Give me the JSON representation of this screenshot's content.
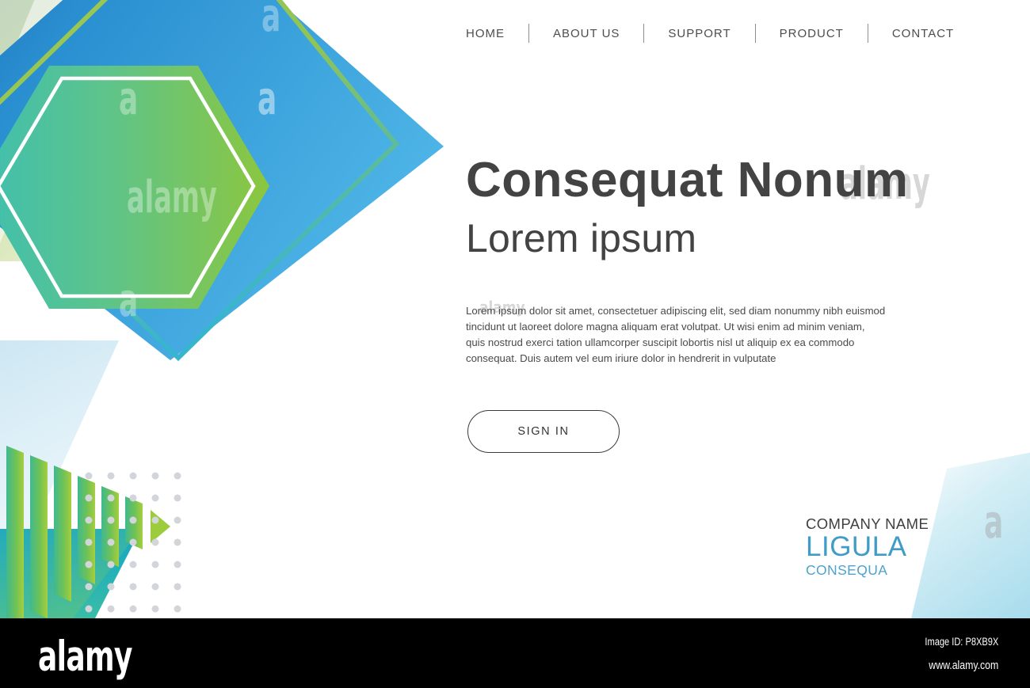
{
  "nav": {
    "items": [
      {
        "label": "HOME",
        "name": "nav-item-home"
      },
      {
        "label": "ABOUT US",
        "name": "nav-item-about-us"
      },
      {
        "label": "SUPPORT",
        "name": "nav-item-support"
      },
      {
        "label": "PRODUCT",
        "name": "nav-item-product"
      },
      {
        "label": "CONTACT",
        "name": "nav-item-contact"
      }
    ]
  },
  "hero": {
    "headline": "Consequat  Nonum",
    "subheadline": "Lorem ipsum",
    "paragraph": "Lorem ipsum dolor sit amet, consectetuer adipiscing elit, sed diam nonummy nibh euismod tincidunt ut laoreet dolore magna aliquam erat volutpat. Ut wisi enim ad minim veniam, quis nostrud exerci tation ullamcorper suscipit lobortis nisl ut aliquip ex ea commodo consequat. Duis autem vel eum iriure dolor in hendrerit in vulputate",
    "cta_label": "SIGN  IN"
  },
  "logo": {
    "company_name": "COMPANY NAME",
    "brand": "LIGULA",
    "tagline": "CONSEQUA"
  },
  "footer": {
    "brand": "alamy",
    "image_id": "Image ID: P8XB9X",
    "url": "www.alamy.com"
  },
  "watermark": {
    "letter": "a",
    "word": "alamy"
  },
  "colors": {
    "brand_blue": "#3e9cc6",
    "tagline_blue": "#4fa3cc",
    "heading_gray": "#434343",
    "nav_gray": "#4d4d4d",
    "hexagon_teal": "#45c0a8",
    "hexagon_green": "#8cc63e",
    "diamond_dark_blue": "#1f72bb",
    "diamond_light_blue": "#4badde",
    "lime_outline": "#a6c94a",
    "cyan_band": "#17a8c4",
    "dot_gray": "#d2d6db",
    "footer_black": "#000000"
  }
}
